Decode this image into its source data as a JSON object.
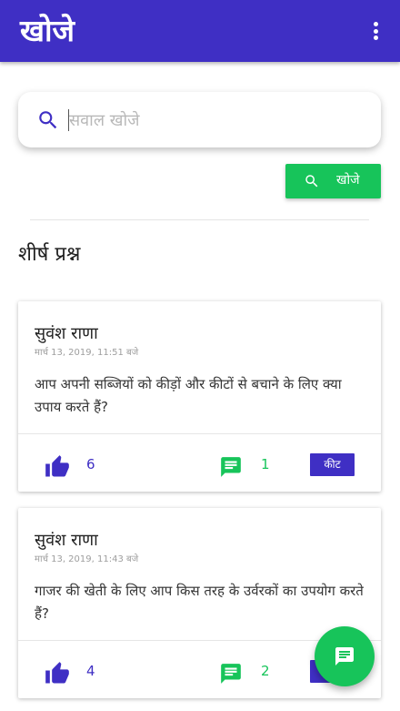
{
  "app_bar": {
    "title": "खोजे",
    "menu_icon": "more-vert-icon"
  },
  "search": {
    "placeholder": "सवाल खोजे",
    "value": "",
    "icon": "search-icon",
    "button_label": "खोजे"
  },
  "section": {
    "title": "शीर्ष प्रश्न"
  },
  "questions": [
    {
      "author": "सुवंश राणा",
      "timestamp": "मार्च 13, 2019, 11:51 बजे",
      "text": "आप अपनी सब्जियों को कीड़ों और कीटों से बचाने के लिए क्या उपाय करते हैं?",
      "likes": "6",
      "comments": "1",
      "tag": "कीट"
    },
    {
      "author": "सुवंश राणा",
      "timestamp": "मार्च 13, 2019, 11:43 बजे",
      "text": "गाजर की खेती के लिए आप किस तरह के उर्वरकों का उपयोग करते हैं?",
      "likes": "4",
      "comments": "2",
      "tag": ""
    }
  ],
  "fab": {
    "icon": "chat-icon"
  },
  "colors": {
    "primary": "#3f2fc4",
    "accent": "#17c45a",
    "background": "#ffffff"
  }
}
